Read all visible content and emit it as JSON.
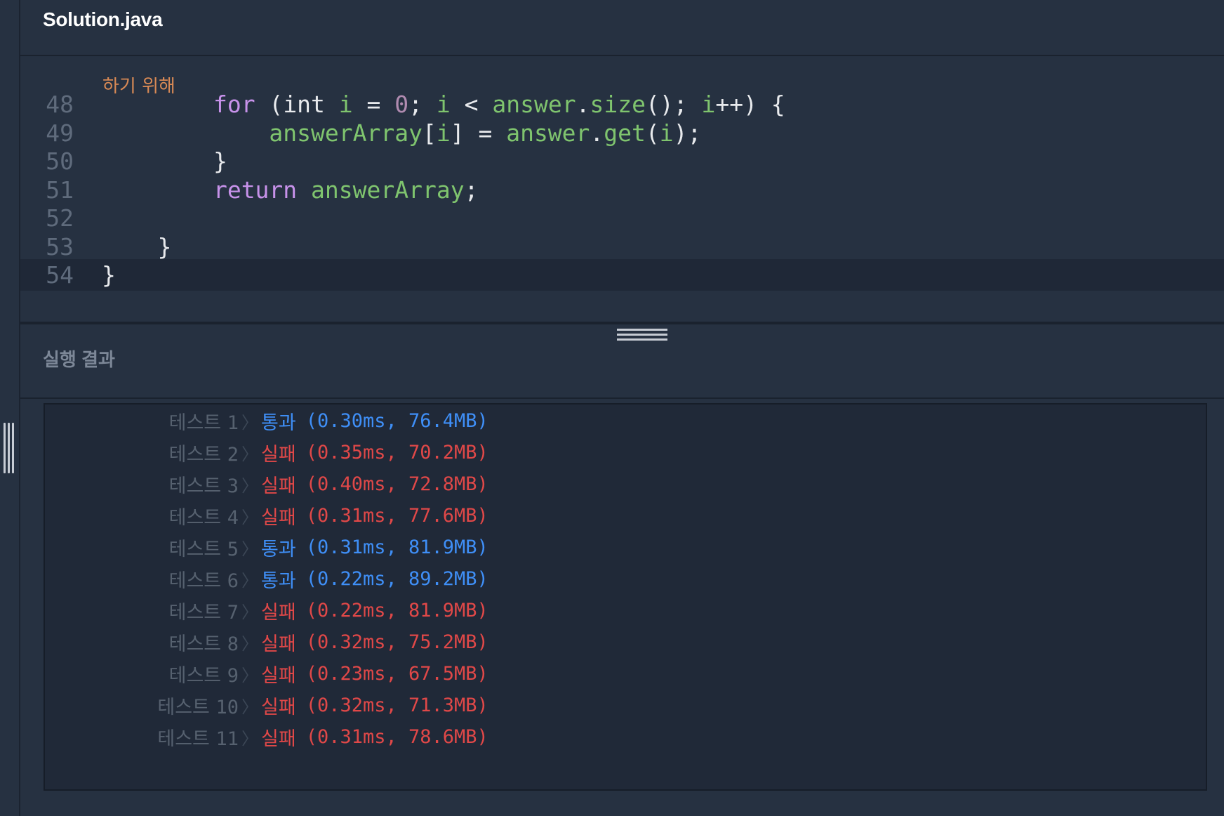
{
  "header": {
    "file_name": "Solution.java"
  },
  "editor": {
    "comment_fragment": "하기 위해",
    "lines": [
      {
        "num": "48",
        "tokens": [
          {
            "t": "        "
          },
          {
            "t": "for",
            "c": "kw"
          },
          {
            "t": " ("
          },
          {
            "t": "int",
            "c": "op"
          },
          {
            "t": " "
          },
          {
            "t": "i",
            "c": "var"
          },
          {
            "t": " = "
          },
          {
            "t": "0",
            "c": "num"
          },
          {
            "t": "; "
          },
          {
            "t": "i",
            "c": "var"
          },
          {
            "t": " < "
          },
          {
            "t": "answer",
            "c": "var"
          },
          {
            "t": "."
          },
          {
            "t": "size",
            "c": "fn"
          },
          {
            "t": "(); "
          },
          {
            "t": "i",
            "c": "var"
          },
          {
            "t": "++) {"
          }
        ]
      },
      {
        "num": "49",
        "tokens": [
          {
            "t": "            "
          },
          {
            "t": "answerArray",
            "c": "var"
          },
          {
            "t": "["
          },
          {
            "t": "i",
            "c": "var"
          },
          {
            "t": "] = "
          },
          {
            "t": "answer",
            "c": "var"
          },
          {
            "t": "."
          },
          {
            "t": "get",
            "c": "fn"
          },
          {
            "t": "("
          },
          {
            "t": "i",
            "c": "var"
          },
          {
            "t": ");"
          }
        ]
      },
      {
        "num": "50",
        "tokens": [
          {
            "t": "        }"
          }
        ]
      },
      {
        "num": "51",
        "tokens": [
          {
            "t": "        "
          },
          {
            "t": "return",
            "c": "kw"
          },
          {
            "t": " "
          },
          {
            "t": "answerArray",
            "c": "var"
          },
          {
            "t": ";"
          }
        ]
      },
      {
        "num": "52",
        "tokens": [
          {
            "t": ""
          }
        ]
      },
      {
        "num": "53",
        "tokens": [
          {
            "t": "    }"
          }
        ]
      },
      {
        "num": "54",
        "tokens": [
          {
            "t": "}"
          }
        ],
        "current": true
      }
    ]
  },
  "result": {
    "title": "실행 결과",
    "label_prefix": "테스트",
    "tests": [
      {
        "n": "1",
        "status": "통과",
        "pass": true,
        "detail": "(0.30ms, 76.4MB)"
      },
      {
        "n": "2",
        "status": "실패",
        "pass": false,
        "detail": "(0.35ms, 70.2MB)"
      },
      {
        "n": "3",
        "status": "실패",
        "pass": false,
        "detail": "(0.40ms, 72.8MB)"
      },
      {
        "n": "4",
        "status": "실패",
        "pass": false,
        "detail": "(0.31ms, 77.6MB)"
      },
      {
        "n": "5",
        "status": "통과",
        "pass": true,
        "detail": "(0.31ms, 81.9MB)"
      },
      {
        "n": "6",
        "status": "통과",
        "pass": true,
        "detail": "(0.22ms, 89.2MB)"
      },
      {
        "n": "7",
        "status": "실패",
        "pass": false,
        "detail": "(0.22ms, 81.9MB)"
      },
      {
        "n": "8",
        "status": "실패",
        "pass": false,
        "detail": "(0.32ms, 75.2MB)"
      },
      {
        "n": "9",
        "status": "실패",
        "pass": false,
        "detail": "(0.23ms, 67.5MB)"
      },
      {
        "n": "10",
        "status": "실패",
        "pass": false,
        "detail": "(0.32ms, 71.3MB)"
      },
      {
        "n": "11",
        "status": "실패",
        "pass": false,
        "detail": "(0.31ms, 78.6MB)"
      }
    ]
  },
  "colors": {
    "pass": "#3f8ff7",
    "fail": "#e04848",
    "background": "#263141"
  }
}
